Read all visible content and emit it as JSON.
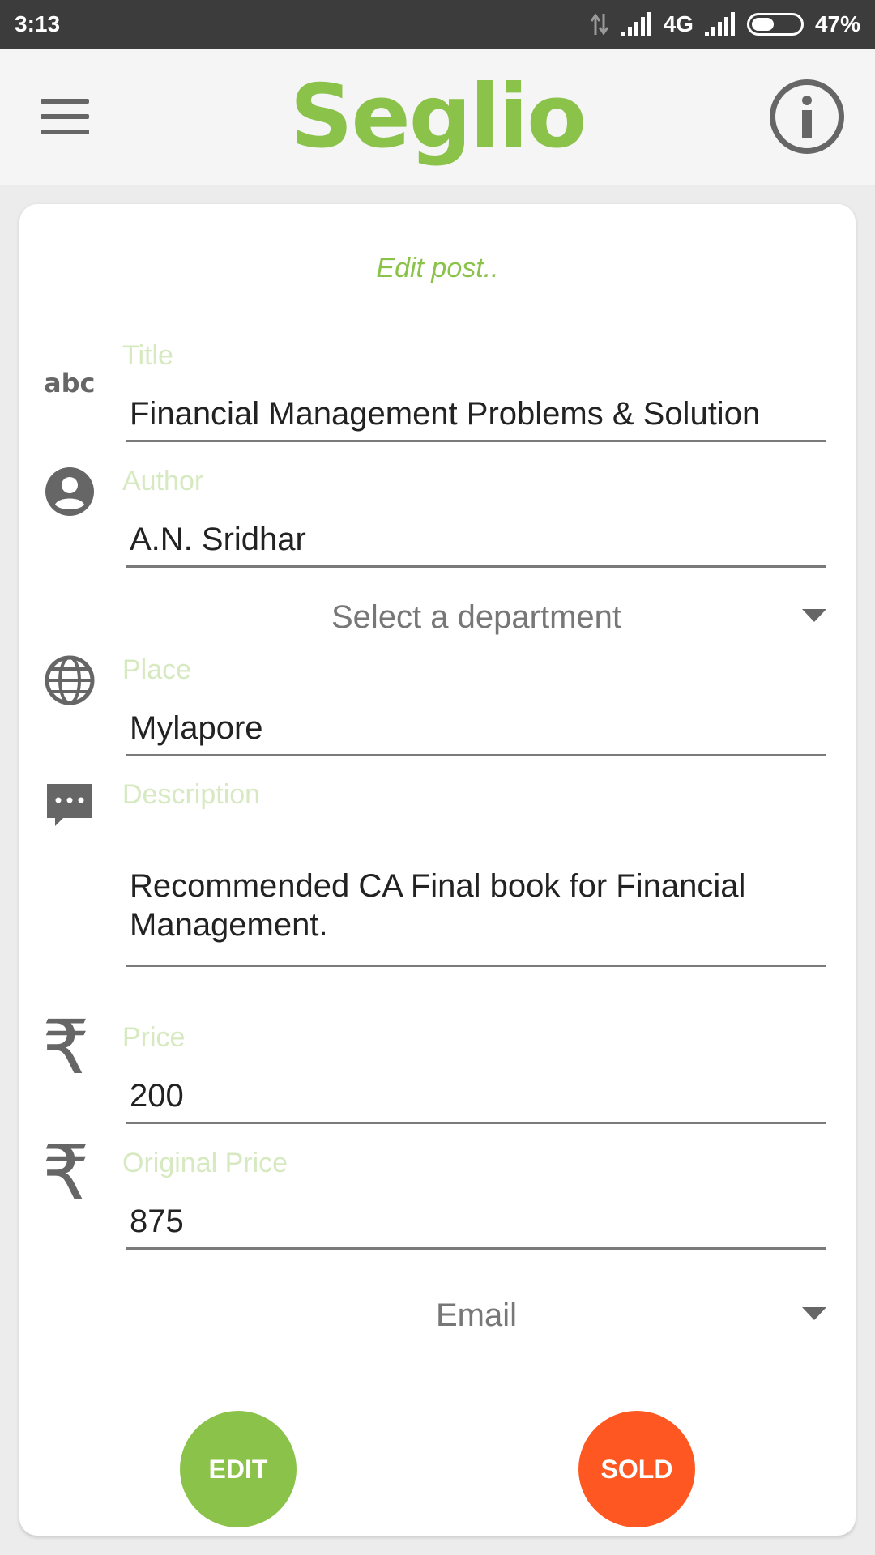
{
  "status_bar": {
    "time": "3:13",
    "network": "4G",
    "battery": "47%",
    "battery_level": 0.47
  },
  "app_bar": {
    "logo": "Seglio",
    "menu_icon": "hamburger-menu-icon",
    "info_icon": "info-icon"
  },
  "form": {
    "heading": "Edit post..",
    "title": {
      "label": "Title",
      "value": "Financial Management Problems & Solution",
      "icon": "abc-text-icon"
    },
    "author": {
      "label": "Author",
      "value": "A.N. Sridhar",
      "icon": "account-circle-icon"
    },
    "department": {
      "value": "Select a department"
    },
    "place": {
      "label": "Place",
      "value": "Mylapore",
      "icon": "globe-icon"
    },
    "description": {
      "label": "Description",
      "value": "Recommended CA Final book for Financial Management.",
      "icon": "comment-icon"
    },
    "price": {
      "label": "Price",
      "value": "200",
      "icon": "rupee-icon",
      "symbol": "₹"
    },
    "original_price": {
      "label": "Original Price",
      "value": "875",
      "icon": "rupee-icon",
      "symbol": "₹"
    },
    "contact": {
      "value": "Email"
    }
  },
  "actions": {
    "edit_label": "EDIT",
    "sold_label": "SOLD"
  },
  "colors": {
    "brand_green": "#8bc34a",
    "sold_orange": "#ff5722",
    "label_green": "#d6e9c0",
    "icon_gray": "#666666"
  }
}
